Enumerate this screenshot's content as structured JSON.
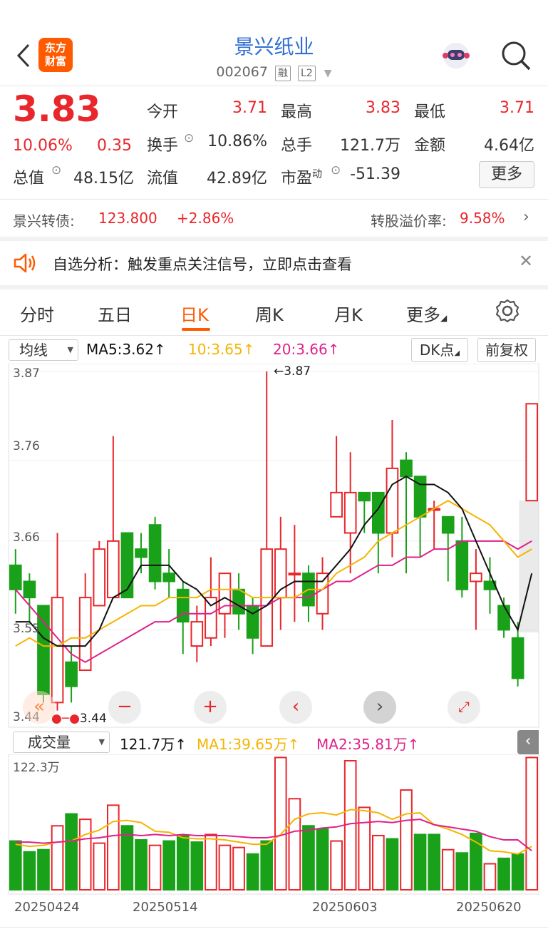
{
  "header": {
    "back_icon": "chevron-left",
    "logo_text_1": "东方",
    "logo_text_2": "财富",
    "title": "景兴纸业",
    "code": "002067",
    "tag_1": "融",
    "tag_2": "L2"
  },
  "quote": {
    "price": "3.83",
    "change_pct": "10.06%",
    "change": "0.35",
    "open_label": "今开",
    "open": "3.71",
    "high_label": "最高",
    "high": "3.83",
    "low_label": "最低",
    "low": "3.71",
    "turnover_label": "换手",
    "turnover": "10.86%",
    "vol_label": "总手",
    "vol": "121.7万",
    "amount_label": "金额",
    "amount": "4.64亿",
    "mktcap_label": "总值",
    "mktcap": "48.15亿",
    "float_label": "流值",
    "float": "42.89亿",
    "pe_label": "市盈",
    "pe_sup": "动",
    "pe": "-51.39",
    "more": "更多"
  },
  "bond": {
    "label": "景兴转债:",
    "price": "123.800",
    "pct": "+2.86%",
    "premium_label": "转股溢价率:",
    "premium": "9.58%"
  },
  "notice": {
    "text": "自选分析：触发重点关注信号，立即点击查看"
  },
  "tabs": [
    "分时",
    "五日",
    "日K",
    "周K",
    "月K",
    "更多"
  ],
  "ma_bar": {
    "select": "均线",
    "ma5": "MA5:3.62↑",
    "ma10": "10:3.65↑",
    "ma20": "20:3.66↑",
    "dk": "DK点",
    "fq": "前复权"
  },
  "axis": {
    "y1": "3.87",
    "y2": "3.76",
    "y3": "3.66",
    "y4": "3.55",
    "y5": "3.44",
    "high_mark": "←3.87",
    "low_mark": "3.44"
  },
  "vol_bar": {
    "select": "成交量",
    "vol": "121.7万↑",
    "ma1": "MA1:39.65万↑",
    "ma2": "MA2:35.81万↑",
    "top": "122.3万"
  },
  "dates": [
    "20250424",
    "20250514",
    "20250603",
    "20250620"
  ],
  "colors": {
    "up": "#e8262b",
    "down": "#1aa11a",
    "ma5": "#111111",
    "ma10": "#f5b400",
    "ma20": "#e0208a",
    "accent": "#ff5a00",
    "link": "#2f6fd1"
  },
  "chart_data": {
    "type": "candlestick",
    "ylim": [
      3.44,
      3.87
    ],
    "candles": [
      [
        3.63,
        3.6,
        3.65,
        3.57
      ],
      [
        3.61,
        3.59,
        3.62,
        3.56
      ],
      [
        3.58,
        3.47,
        3.58,
        3.46
      ],
      [
        3.46,
        3.59,
        3.67,
        3.45
      ],
      [
        3.51,
        3.48,
        3.53,
        3.46
      ],
      [
        3.5,
        3.59,
        3.62,
        3.5
      ],
      [
        3.58,
        3.65,
        3.66,
        3.58
      ],
      [
        3.59,
        3.66,
        3.79,
        3.59
      ],
      [
        3.67,
        3.59,
        3.67,
        3.59
      ],
      [
        3.65,
        3.64,
        3.67,
        3.62
      ],
      [
        3.68,
        3.61,
        3.69,
        3.6
      ],
      [
        3.62,
        3.61,
        3.65,
        3.59
      ],
      [
        3.6,
        3.56,
        3.61,
        3.52
      ],
      [
        3.53,
        3.56,
        3.58,
        3.51
      ],
      [
        3.54,
        3.59,
        3.64,
        3.53
      ],
      [
        3.57,
        3.62,
        3.62,
        3.54
      ],
      [
        3.6,
        3.57,
        3.62,
        3.55
      ],
      [
        3.58,
        3.54,
        3.59,
        3.52
      ],
      [
        3.53,
        3.65,
        3.87,
        3.53
      ],
      [
        3.59,
        3.65,
        3.69,
        3.55
      ],
      [
        3.62,
        3.62,
        3.68,
        3.56
      ],
      [
        3.62,
        3.58,
        3.63,
        3.56
      ],
      [
        3.57,
        3.62,
        3.64,
        3.55
      ],
      [
        3.69,
        3.72,
        3.79,
        3.69
      ],
      [
        3.67,
        3.72,
        3.77,
        3.62
      ],
      [
        3.72,
        3.71,
        3.72,
        3.67
      ],
      [
        3.72,
        3.67,
        3.72,
        3.62
      ],
      [
        3.67,
        3.75,
        3.81,
        3.64
      ],
      [
        3.76,
        3.74,
        3.77,
        3.62
      ],
      [
        3.74,
        3.69,
        3.74,
        3.64
      ],
      [
        3.7,
        3.7,
        3.71,
        3.65
      ],
      [
        3.69,
        3.67,
        3.69,
        3.61
      ],
      [
        3.66,
        3.6,
        3.69,
        3.59
      ],
      [
        3.61,
        3.62,
        3.65,
        3.55
      ],
      [
        3.61,
        3.6,
        3.64,
        3.57
      ],
      [
        3.58,
        3.55,
        3.59,
        3.54
      ],
      [
        3.54,
        3.49,
        3.56,
        3.48
      ],
      [
        3.71,
        3.83,
        3.83,
        3.71
      ]
    ],
    "ma5": [
      3.56,
      3.56,
      3.54,
      3.53,
      3.53,
      3.53,
      3.55,
      3.59,
      3.6,
      3.63,
      3.63,
      3.63,
      3.61,
      3.6,
      3.58,
      3.59,
      3.58,
      3.57,
      3.58,
      3.6,
      3.61,
      3.61,
      3.61,
      3.63,
      3.65,
      3.68,
      3.7,
      3.73,
      3.74,
      3.73,
      3.73,
      3.72,
      3.7,
      3.66,
      3.62,
      3.58,
      3.55,
      3.62
    ],
    "ma10": [
      3.53,
      3.54,
      3.53,
      3.53,
      3.54,
      3.54,
      3.55,
      3.56,
      3.57,
      3.58,
      3.58,
      3.59,
      3.59,
      3.59,
      3.6,
      3.6,
      3.6,
      3.59,
      3.59,
      3.59,
      3.59,
      3.6,
      3.6,
      3.62,
      3.63,
      3.64,
      3.66,
      3.67,
      3.68,
      3.69,
      3.7,
      3.71,
      3.7,
      3.69,
      3.68,
      3.66,
      3.64,
      3.65
    ],
    "ma20": [
      3.6,
      3.58,
      3.56,
      3.54,
      3.52,
      3.51,
      3.52,
      3.53,
      3.54,
      3.55,
      3.56,
      3.56,
      3.57,
      3.57,
      3.57,
      3.58,
      3.58,
      3.58,
      3.58,
      3.59,
      3.59,
      3.59,
      3.6,
      3.61,
      3.61,
      3.62,
      3.63,
      3.63,
      3.64,
      3.64,
      3.65,
      3.65,
      3.66,
      3.66,
      3.66,
      3.66,
      3.65,
      3.66
    ],
    "volume": [
      [
        45,
        0
      ],
      [
        35,
        0
      ],
      [
        37,
        0
      ],
      [
        59,
        1
      ],
      [
        70,
        0
      ],
      [
        65,
        1
      ],
      [
        43,
        1
      ],
      [
        78,
        1
      ],
      [
        59,
        0
      ],
      [
        46,
        0
      ],
      [
        41,
        1
      ],
      [
        45,
        0
      ],
      [
        50,
        0
      ],
      [
        44,
        0
      ],
      [
        51,
        1
      ],
      [
        41,
        1
      ],
      [
        39,
        1
      ],
      [
        33,
        0
      ],
      [
        45,
        0
      ],
      [
        122,
        1
      ],
      [
        84,
        1
      ],
      [
        59,
        0
      ],
      [
        56,
        0
      ],
      [
        45,
        1
      ],
      [
        119,
        1
      ],
      [
        76,
        1
      ],
      [
        50,
        1
      ],
      [
        47,
        0
      ],
      [
        92,
        1
      ],
      [
        51,
        0
      ],
      [
        51,
        0
      ],
      [
        37,
        1
      ],
      [
        34,
        0
      ],
      [
        52,
        0
      ],
      [
        24,
        1
      ],
      [
        29,
        0
      ],
      [
        33,
        0
      ],
      [
        122,
        1
      ]
    ],
    "vma1": [
      42,
      40,
      41,
      44,
      45,
      51,
      55,
      63,
      64,
      62,
      54,
      53,
      48,
      47,
      47,
      46,
      44,
      42,
      42,
      51,
      65,
      70,
      71,
      69,
      74,
      73,
      71,
      65,
      70,
      71,
      60,
      56,
      51,
      44,
      36,
      35,
      33,
      40
    ],
    "vma2": [
      44,
      44,
      43,
      44,
      45,
      47,
      48,
      50,
      51,
      50,
      51,
      50,
      51,
      50,
      50,
      50,
      49,
      48,
      48,
      50,
      54,
      55,
      57,
      58,
      61,
      62,
      63,
      62,
      64,
      65,
      60,
      58,
      56,
      54,
      49,
      46,
      46,
      36
    ]
  }
}
